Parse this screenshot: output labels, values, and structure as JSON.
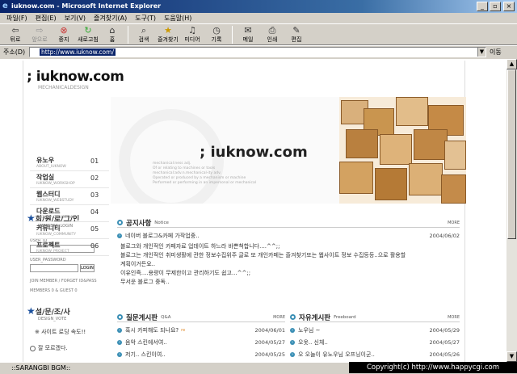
{
  "window": {
    "title": "iuknow.com - Microsoft Internet Explorer"
  },
  "menu": [
    "파일(F)",
    "편집(E)",
    "보기(V)",
    "즐겨찾기(A)",
    "도구(T)",
    "도움말(H)"
  ],
  "toolbar": [
    {
      "label": "뒤로",
      "icon": "back-arrow-icon",
      "enabled": true
    },
    {
      "label": "앞으로",
      "icon": "forward-arrow-icon",
      "enabled": false
    },
    {
      "label": "중지",
      "icon": "stop-icon",
      "enabled": true
    },
    {
      "label": "새로고침",
      "icon": "refresh-icon",
      "enabled": true
    },
    {
      "label": "홈",
      "icon": "home-icon",
      "enabled": true
    },
    {
      "label": "검색",
      "icon": "search-icon",
      "enabled": true
    },
    {
      "label": "즐겨찾기",
      "icon": "favorites-icon",
      "enabled": true
    },
    {
      "label": "미디어",
      "icon": "media-icon",
      "enabled": true
    },
    {
      "label": "기록",
      "icon": "history-icon",
      "enabled": true
    },
    {
      "label": "메일",
      "icon": "mail-icon",
      "enabled": true
    },
    {
      "label": "인쇄",
      "icon": "print-icon",
      "enabled": true
    },
    {
      "label": "편집",
      "icon": "edit-icon",
      "enabled": true
    }
  ],
  "address": {
    "label": "주소(D)",
    "url": "http://www.iuknow.com/",
    "go": "이동"
  },
  "site": {
    "logo": "; iuknow.com",
    "logo_sub": "MECHANICALDESIGN",
    "nav": [
      {
        "label": "유노우",
        "sub": "ABOUT_IUKNOW",
        "num": "01"
      },
      {
        "label": "작업실",
        "sub": "IUKNOW_WORKSHOP",
        "num": "02"
      },
      {
        "label": "웹스터디",
        "sub": "IUKNOW_WEBSTUDY",
        "num": "03"
      },
      {
        "label": "다운로드",
        "sub": "IUKNOW_DOWNLOAD",
        "num": "04"
      },
      {
        "label": "커뮤니티",
        "sub": "IUKNOW_COMMUNITY",
        "num": "05"
      },
      {
        "label": "프로젝트",
        "sub": "IUKNOW_PROJECT",
        "num": "06"
      }
    ],
    "banner": {
      "logo": "; iuknow.com",
      "lines": [
        "mechanical:ness adj.",
        "Of or relating to machines or tools",
        "mechanical:adv.n.mechanical-ity adv.",
        "Operated or produced by a mechanism or machine",
        "Performed or performing in an impersonal or mechanical"
      ]
    },
    "login": {
      "title": "회/원/로/그/인",
      "sub": "MEMBERS_LOGIN",
      "id_label": "USER_ID",
      "pw_label": "USER_PASSWORD",
      "button": "LOGIN",
      "links": "JOIN MEMBER / FORGET ID&PASS",
      "stats": "MEMBERS 0 & GUEST 0"
    },
    "survey": {
      "title": "설/문/조/사",
      "sub": "DESIGN_VOTE",
      "question": "※ 사이트 로딩 속도!!",
      "option": "잘 모르겠다."
    },
    "notice": {
      "title": "공지사항",
      "title_en": "Notice",
      "more": "MORE",
      "items": [
        {
          "title": "네이버 블로그&카페 가작업중..",
          "date": "2004/06/02"
        }
      ],
      "body": [
        "블로그와 개인적인 카페자료 업데이트 하느라 바쁜척합니다....^^;;",
        "블로그는 개인적인 취미생활에 관한 정보수집위주 글로 또 개인카페는 즐겨찾기또는 웹사이트 정보 수집등등..으로 활용할",
        "계획이거든요..",
        "이유인즉....용량이 무제한이고 관리하기도 쉽고...^^;;",
        "무서운 블로그 중독.."
      ]
    },
    "qna": {
      "title": "질문게시판",
      "title_en": "Q&A",
      "more": "MORE",
      "items": [
        {
          "title": "혹시 카피해도 되나요?",
          "badge": "re",
          "date": "2004/06/01"
        },
        {
          "title": "음악 스킨에서여..",
          "date": "2004/05/27"
        },
        {
          "title": "저기.. 스킨이여..",
          "date": "2004/05/25"
        }
      ]
    },
    "free": {
      "title": "자유게시판",
      "title_en": "Freeboard",
      "more": "MORE",
      "items": [
        {
          "title": "노우님 ~",
          "date": "2004/05/29"
        },
        {
          "title": "오옷.. 신체..",
          "date": "2004/05/27"
        },
        {
          "title": "오 오늘이 유노우님 오프닝이군..",
          "date": "2004/05/26"
        }
      ]
    }
  },
  "status": {
    "text": "::SARANGBI BGM::",
    "overlay": "Copyright(c) http://www.happycgi.com"
  }
}
